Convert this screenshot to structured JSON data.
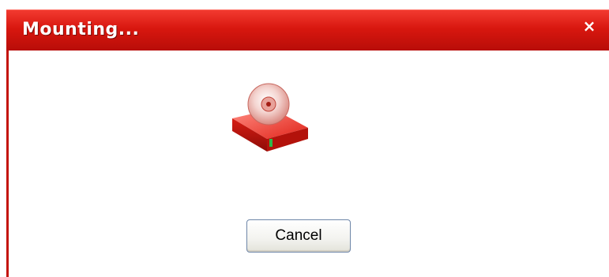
{
  "window": {
    "title": "Mounting...",
    "close_glyph": "×"
  },
  "content": {
    "icon": "disc-drive-icon"
  },
  "buttons": {
    "cancel_label": "Cancel"
  },
  "colors": {
    "titlebar": "#d8170f",
    "accent": "#c4140b",
    "button_border": "#6e86a8"
  }
}
